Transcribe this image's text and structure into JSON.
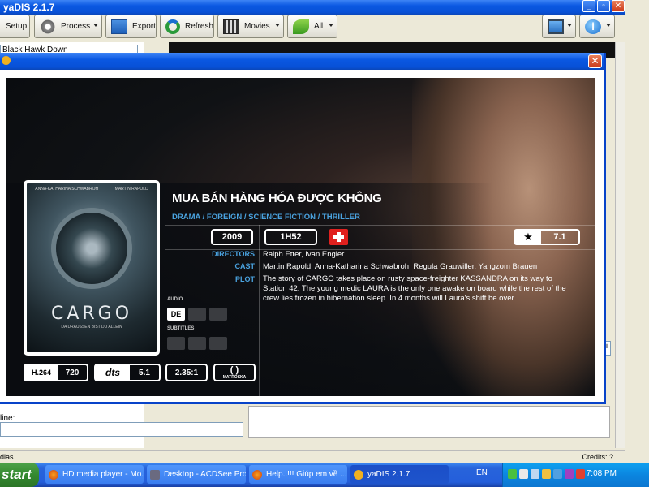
{
  "app": {
    "title": "yaDIS 2.1.7"
  },
  "toolbar": {
    "setup": "Setup",
    "process": "Process",
    "export": "Export",
    "refresh": "Refresh",
    "movies": "Movies",
    "all": "All"
  },
  "left_pane": {
    "tree_item": "Black Hawk Down"
  },
  "filter": {
    "label": "line:"
  },
  "side_ctrl": {
    "label": "li"
  },
  "status": {
    "left": "dias",
    "credits": "Credits: ?"
  },
  "movie": {
    "title": "MUA BÁN HÀNG HÓA ĐƯỢC KHÔNG",
    "genres": "DRAMA / FOREIGN / SCIENCE FICTION / THRILLER",
    "year": "2009",
    "runtime": "1H52",
    "rating": "7.1",
    "rating_symbol": "★",
    "labels": {
      "directors": "DIRECTORS",
      "cast": "CAST",
      "plot": "PLOT",
      "audio": "AUDIO",
      "subtitles": "SUBTITLES"
    },
    "directors": "Ralph Etter, Ivan Engler",
    "cast": "Martin Rapold, Anna-Katharina Schwabroh, Regula Grauwiller, Yangzom Brauen",
    "plot": "The story of CARGO takes place on rusty space-freighter KASSANDRA on its way to Station 42. The young medic LAURA is the only one awake on board while the rest of the crew lies frozen in hibernation sleep. In 4 months will Laura's shift be over.",
    "audio_lang": "DE",
    "poster": {
      "name_left": "ANNA-KATHARINA SCHWABROH",
      "name_right": "MARTIN RAPOLD",
      "title": "CARGO",
      "tagline": "DA DRAUSSEN BIST DU ALLEIN"
    },
    "formats": {
      "video_codec": "H.264",
      "resolution": "720",
      "audio_codec": "dts",
      "channels": "5.1",
      "aspect": "2.35:1",
      "container": "MATROSKA"
    }
  },
  "taskbar": {
    "start": "start",
    "tasks": [
      "HD media player - Mo...",
      "Desktop - ACDSee Pro 3",
      "Help..!!! Giúp em về ...",
      "yaDIS 2.1.7"
    ],
    "lang": "EN",
    "clock": "7:08 PM"
  },
  "colors": {
    "accent_blue": "#4aa3e0",
    "xp_title": "#0a58e2",
    "close_red": "#cc3a1a",
    "swiss_red": "#e0201e"
  }
}
